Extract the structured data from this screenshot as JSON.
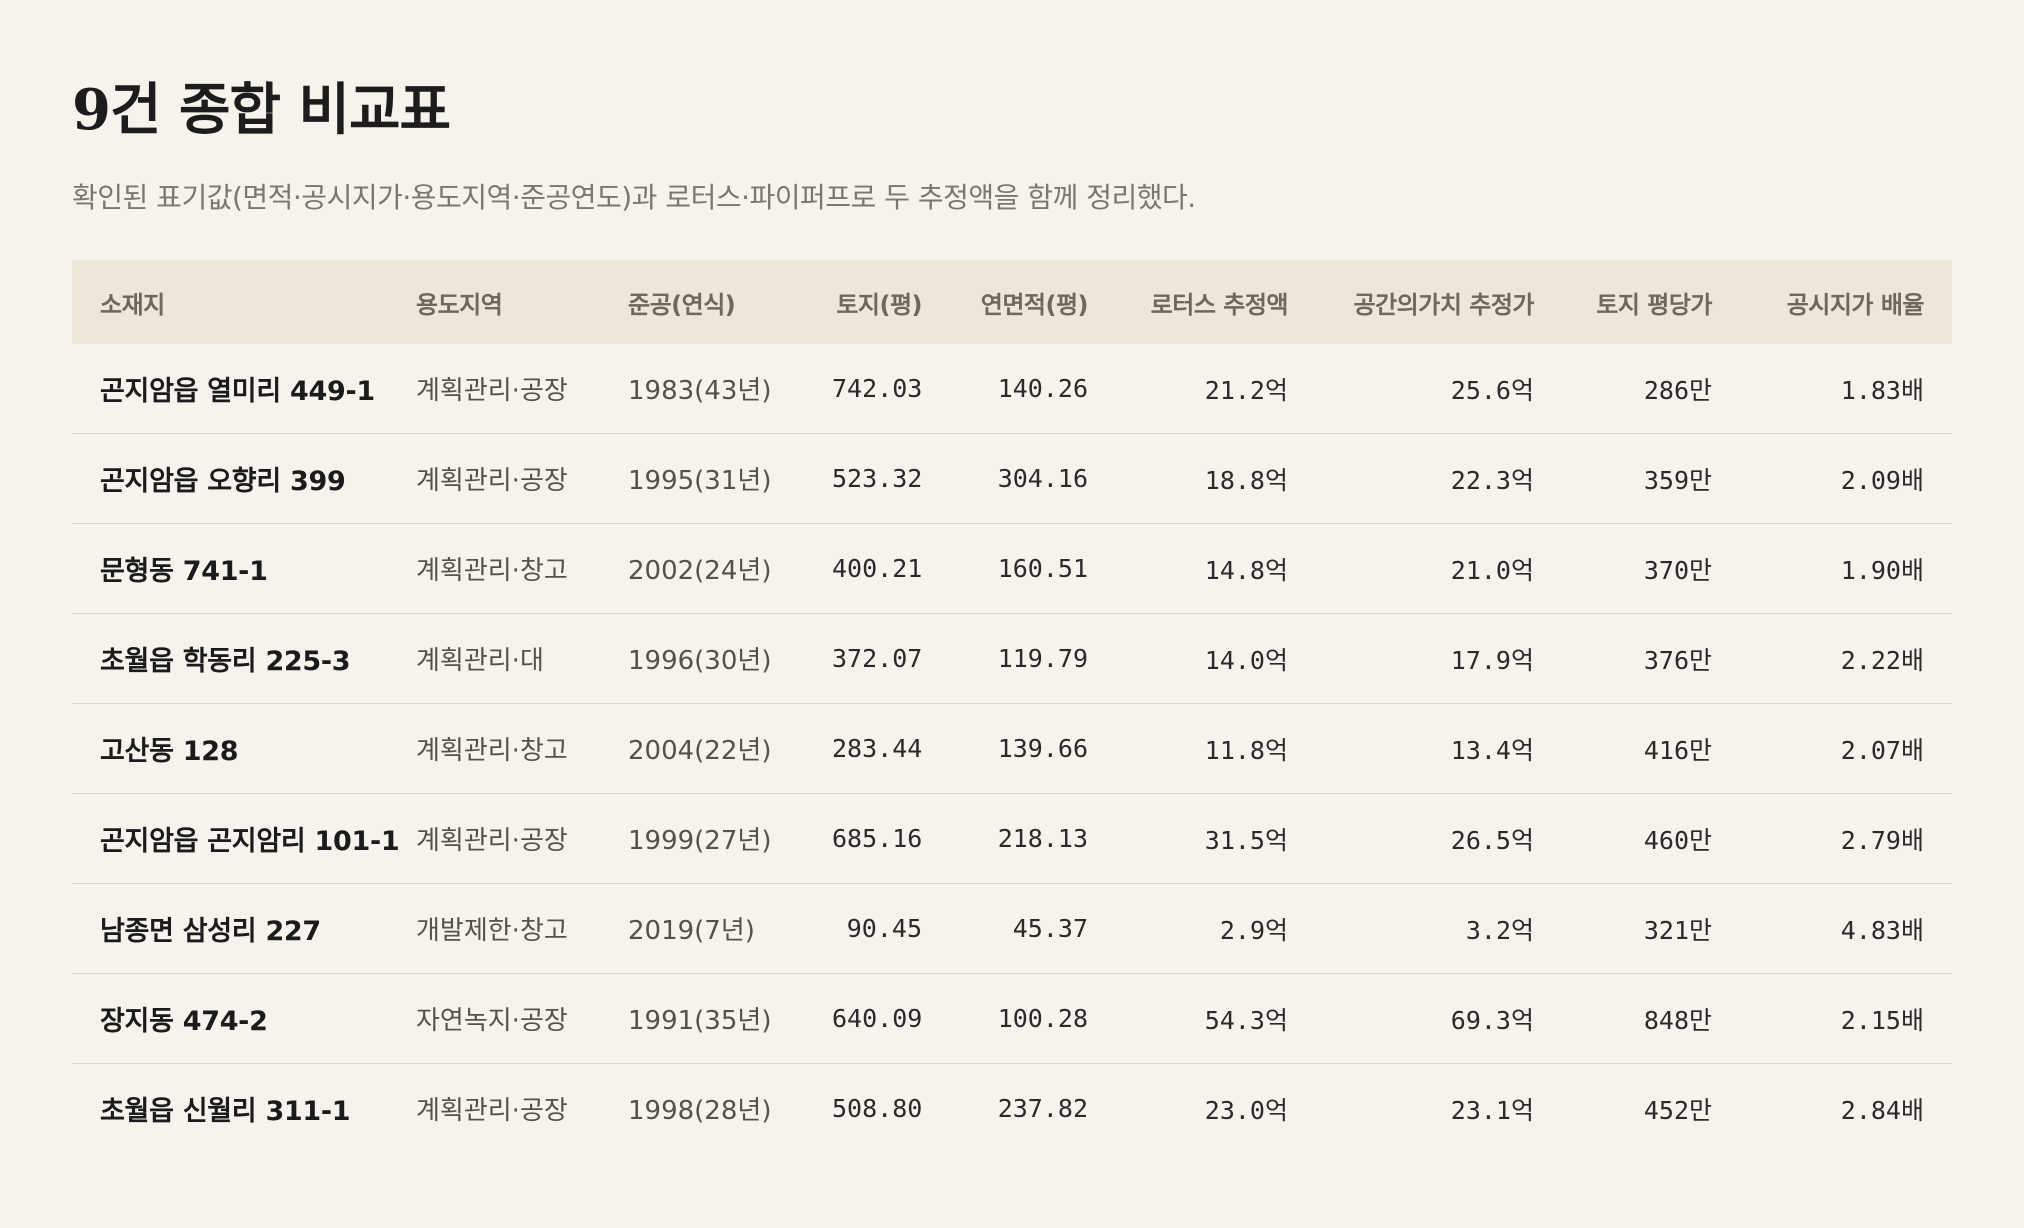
{
  "title": "9건 종합 비교표",
  "subtitle": "확인된 표기값(면적·공시지가·용도지역·준공연도)과 로터스·파이퍼프로 두 추정액을 함께 정리했다.",
  "table": {
    "headers": [
      "소재지",
      "용도지역",
      "준공(연식)",
      "토지(평)",
      "연면적(평)",
      "로터스 추정액",
      "공간의가치 추정가",
      "토지 평당가",
      "공시지가 배율"
    ],
    "rows": [
      [
        "곤지암읍 열미리 449-1",
        "계획관리·공장",
        "1983(43년)",
        "742.03",
        "140.26",
        "21.2억",
        "25.6억",
        "286만",
        "1.83배"
      ],
      [
        "곤지암읍 오향리 399",
        "계획관리·공장",
        "1995(31년)",
        "523.32",
        "304.16",
        "18.8억",
        "22.3억",
        "359만",
        "2.09배"
      ],
      [
        "문형동 741-1",
        "계획관리·창고",
        "2002(24년)",
        "400.21",
        "160.51",
        "14.8억",
        "21.0억",
        "370만",
        "1.90배"
      ],
      [
        "초월읍 학동리 225-3",
        "계획관리·대",
        "1996(30년)",
        "372.07",
        "119.79",
        "14.0억",
        "17.9억",
        "376만",
        "2.22배"
      ],
      [
        "고산동 128",
        "계획관리·창고",
        "2004(22년)",
        "283.44",
        "139.66",
        "11.8억",
        "13.4억",
        "416만",
        "2.07배"
      ],
      [
        "곤지암읍 곤지암리 101-1",
        "계획관리·공장",
        "1999(27년)",
        "685.16",
        "218.13",
        "31.5억",
        "26.5억",
        "460만",
        "2.79배"
      ],
      [
        "남종면 삼성리 227",
        "개발제한·창고",
        "2019(7년)",
        "90.45",
        "45.37",
        "2.9억",
        "3.2억",
        "321만",
        "4.83배"
      ],
      [
        "장지동 474-2",
        "자연녹지·공장",
        "1991(35년)",
        "640.09",
        "100.28",
        "54.3억",
        "69.3억",
        "848만",
        "2.15배"
      ],
      [
        "초월읍 신월리 311-1",
        "계획관리·공장",
        "1998(28년)",
        "508.80",
        "237.82",
        "23.0억",
        "23.1억",
        "452만",
        "2.84배"
      ]
    ]
  }
}
